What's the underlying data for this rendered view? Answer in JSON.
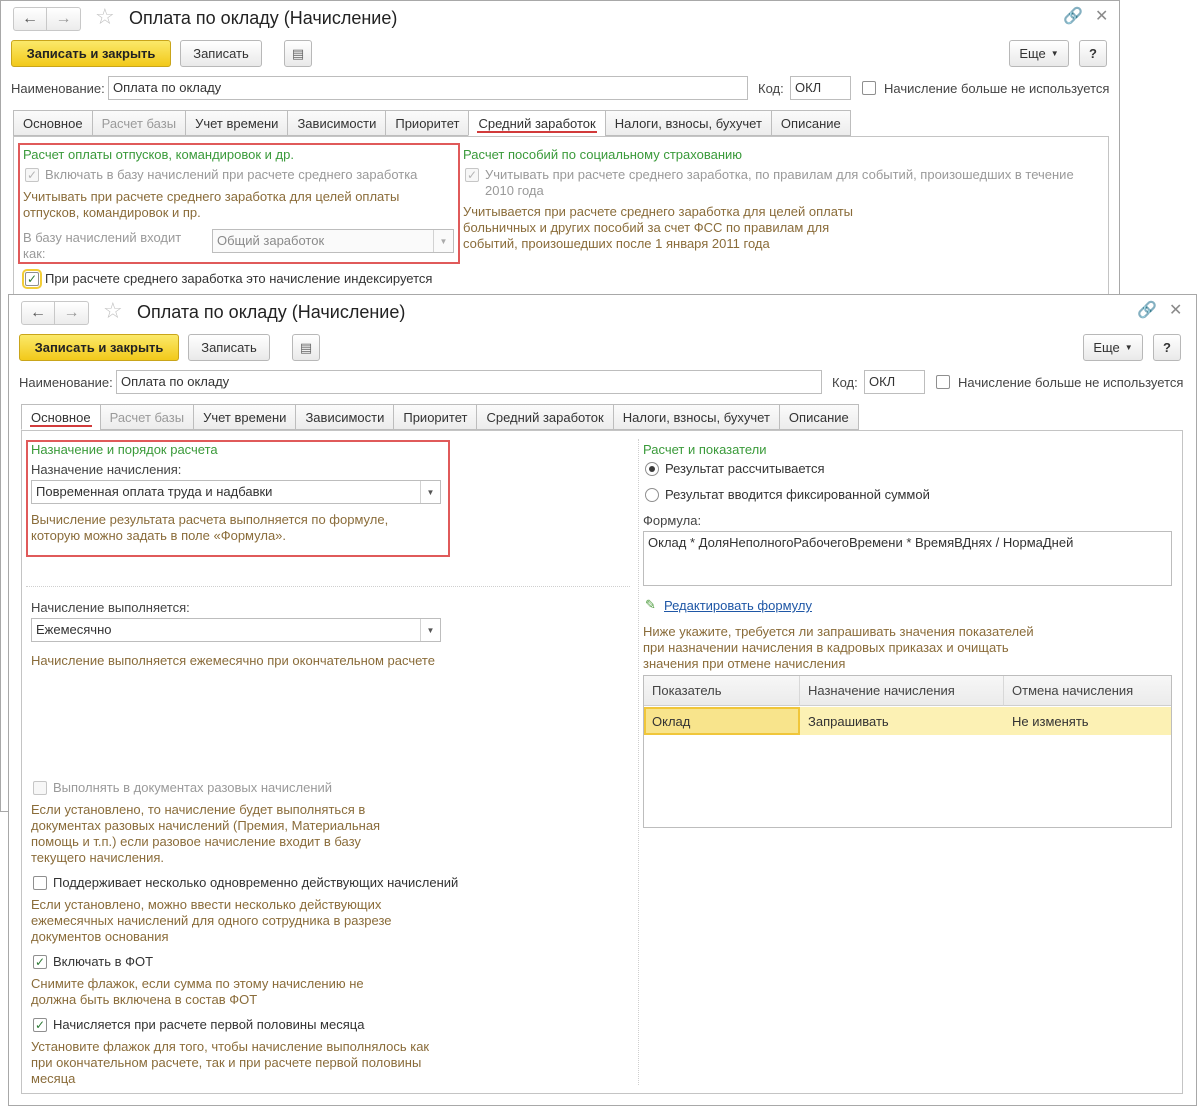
{
  "back_window": {
    "title": "Оплата по окладу (Начисление)",
    "toolbar": {
      "save_close": "Записать и закрыть",
      "save": "Записать",
      "more": "Еще",
      "help": "?"
    },
    "name_label": "Наименование:",
    "name_value": "Оплата по окладу",
    "code_label": "Код:",
    "code_value": "ОКЛ",
    "unused_label": "Начисление больше не используется",
    "tabs": [
      "Основное",
      "Расчет базы",
      "Учет времени",
      "Зависимости",
      "Приоритет",
      "Средний заработок",
      "Налоги, взносы, бухучет",
      "Описание"
    ],
    "left": {
      "header": "Расчет оплаты отпусков, командировок и др.",
      "include_label": "Включать в базу начислений при расчете среднего заработка",
      "include_note": "Учитывать при расчете среднего заработка для целей оплаты отпусков, командировок и пр.",
      "base_label": "В базу начислений входит как:",
      "base_value": "Общий заработок"
    },
    "right": {
      "header": "Расчет пособий по социальному страхованию",
      "include_label": "Учитывать при расчете среднего заработка, по правилам для событий, произошедших в течение 2010 года",
      "note": "Учитывается при расчете среднего заработка для целей оплаты больничных и других пособий за счет ФСС по правилам для событий, произошедших после 1 января 2011 года"
    },
    "indexed_label": "При расчете среднего заработка это начисление индексируется"
  },
  "front_window": {
    "title": "Оплата по окладу (Начисление)",
    "toolbar": {
      "save_close": "Записать и закрыть",
      "save": "Записать",
      "more": "Еще",
      "help": "?"
    },
    "name_label": "Наименование:",
    "name_value": "Оплата по окладу",
    "code_label": "Код:",
    "code_value": "ОКЛ",
    "unused_label": "Начисление больше не используется",
    "tabs": [
      "Основное",
      "Расчет базы",
      "Учет времени",
      "Зависимости",
      "Приоритет",
      "Средний заработок",
      "Налоги, взносы, бухучет",
      "Описание"
    ],
    "left": {
      "purpose_header": "Назначение и порядок расчета",
      "purpose_label": "Назначение начисления:",
      "purpose_value": "Повременная оплата труда и надбавки",
      "purpose_note": "Вычисление результата расчета выполняется по формуле, которую можно задать в поле «Формула».",
      "period_label": "Начисление выполняется:",
      "period_value": "Ежемесячно",
      "period_note": "Начисление выполняется ежемесячно при окончательном расчете",
      "one_time_label": "Выполнять в документах разовых начислений",
      "one_time_note": "Если установлено, то начисление будет выполняться в документах разовых начислений (Премия, Материальная помощь и т.п.) если разовое начисление входит в базу текущего начисления.",
      "multiple_label": "Поддерживает несколько одновременно действующих начислений",
      "multiple_note": "Если установлено, можно ввести несколько действующих ежемесячных начислений для одного сотрудника в разрезе документов основания",
      "fot_label": "Включать в ФОТ",
      "fot_note": "Снимите флажок, если сумма по этому начислению не должна быть включена в состав ФОТ",
      "first_half_label": "Начисляется при расчете первой половины месяца",
      "first_half_note": "Установите флажок для того, чтобы начисление выполнялось как при окончательном расчете, так и при расчете первой половины месяца"
    },
    "right": {
      "header": "Расчет и показатели",
      "radio_calc": "Результат рассчитывается",
      "radio_fixed": "Результат вводится фиксированной суммой",
      "formula_label": "Формула:",
      "formula_value": "Оклад * ДоляНеполногоРабочегоВремени * ВремяВДнях / НормаДней",
      "edit_formula": "Редактировать формулу",
      "indicators_note": "Ниже укажите, требуется ли запрашивать значения показателей при назначении начисления в кадровых приказах и очищать значения при отмене начисления",
      "table": {
        "columns": [
          "Показатель",
          "Назначение начисления",
          "Отмена начисления"
        ],
        "rows": [
          [
            "Оклад",
            "Запрашивать",
            "Не изменять"
          ]
        ]
      }
    }
  }
}
